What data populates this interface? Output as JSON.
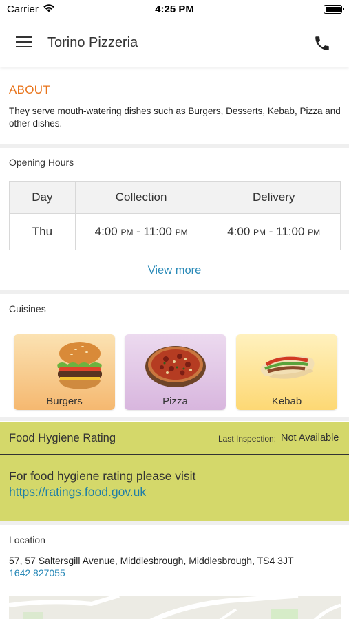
{
  "status_bar": {
    "carrier": "Carrier",
    "time": "4:25 PM"
  },
  "header": {
    "title": "Torino Pizzeria",
    "menu_icon": "hamburger-menu-icon",
    "call_icon": "phone-icon"
  },
  "about": {
    "heading": "ABOUT",
    "text": "They serve mouth-watering dishes such as Burgers, Desserts, Kebab, Pizza and other dishes."
  },
  "opening_hours": {
    "heading": "Opening Hours",
    "columns": [
      "Day",
      "Collection",
      "Delivery"
    ],
    "rows": [
      {
        "day": "Thu",
        "collection": "4:00 PM - 11:00 PM",
        "delivery": "4:00 PM - 11:00 PM"
      }
    ],
    "view_more": "View more"
  },
  "cuisines": {
    "heading": "Cuisines",
    "items": [
      {
        "label": "Burgers",
        "icon": "burger-icon",
        "color_top": "#fbe2b2",
        "color_bottom": "#f5b870"
      },
      {
        "label": "Pizza",
        "icon": "pizza-icon",
        "color_top": "#ecdaef",
        "color_bottom": "#d8b6de"
      },
      {
        "label": "Kebab",
        "icon": "kebab-icon",
        "color_top": "#fff1be",
        "color_bottom": "#fdd874"
      }
    ]
  },
  "hygiene": {
    "title": "Food Hygiene Rating",
    "inspection_label": "Last Inspection:",
    "inspection_value": "Not Available",
    "text": "For food hygiene rating please visit",
    "link": "https://ratings.food.gov.uk",
    "color": "#d4d86a"
  },
  "location": {
    "heading": "Location",
    "address": "57, 57 Saltersgill Avenue, Middlesbrough, Middlesbrough, TS4 3JT",
    "phone": "1642 827055"
  },
  "colors": {
    "accent_orange": "#e8731a",
    "link_blue": "#2a8ab8"
  }
}
